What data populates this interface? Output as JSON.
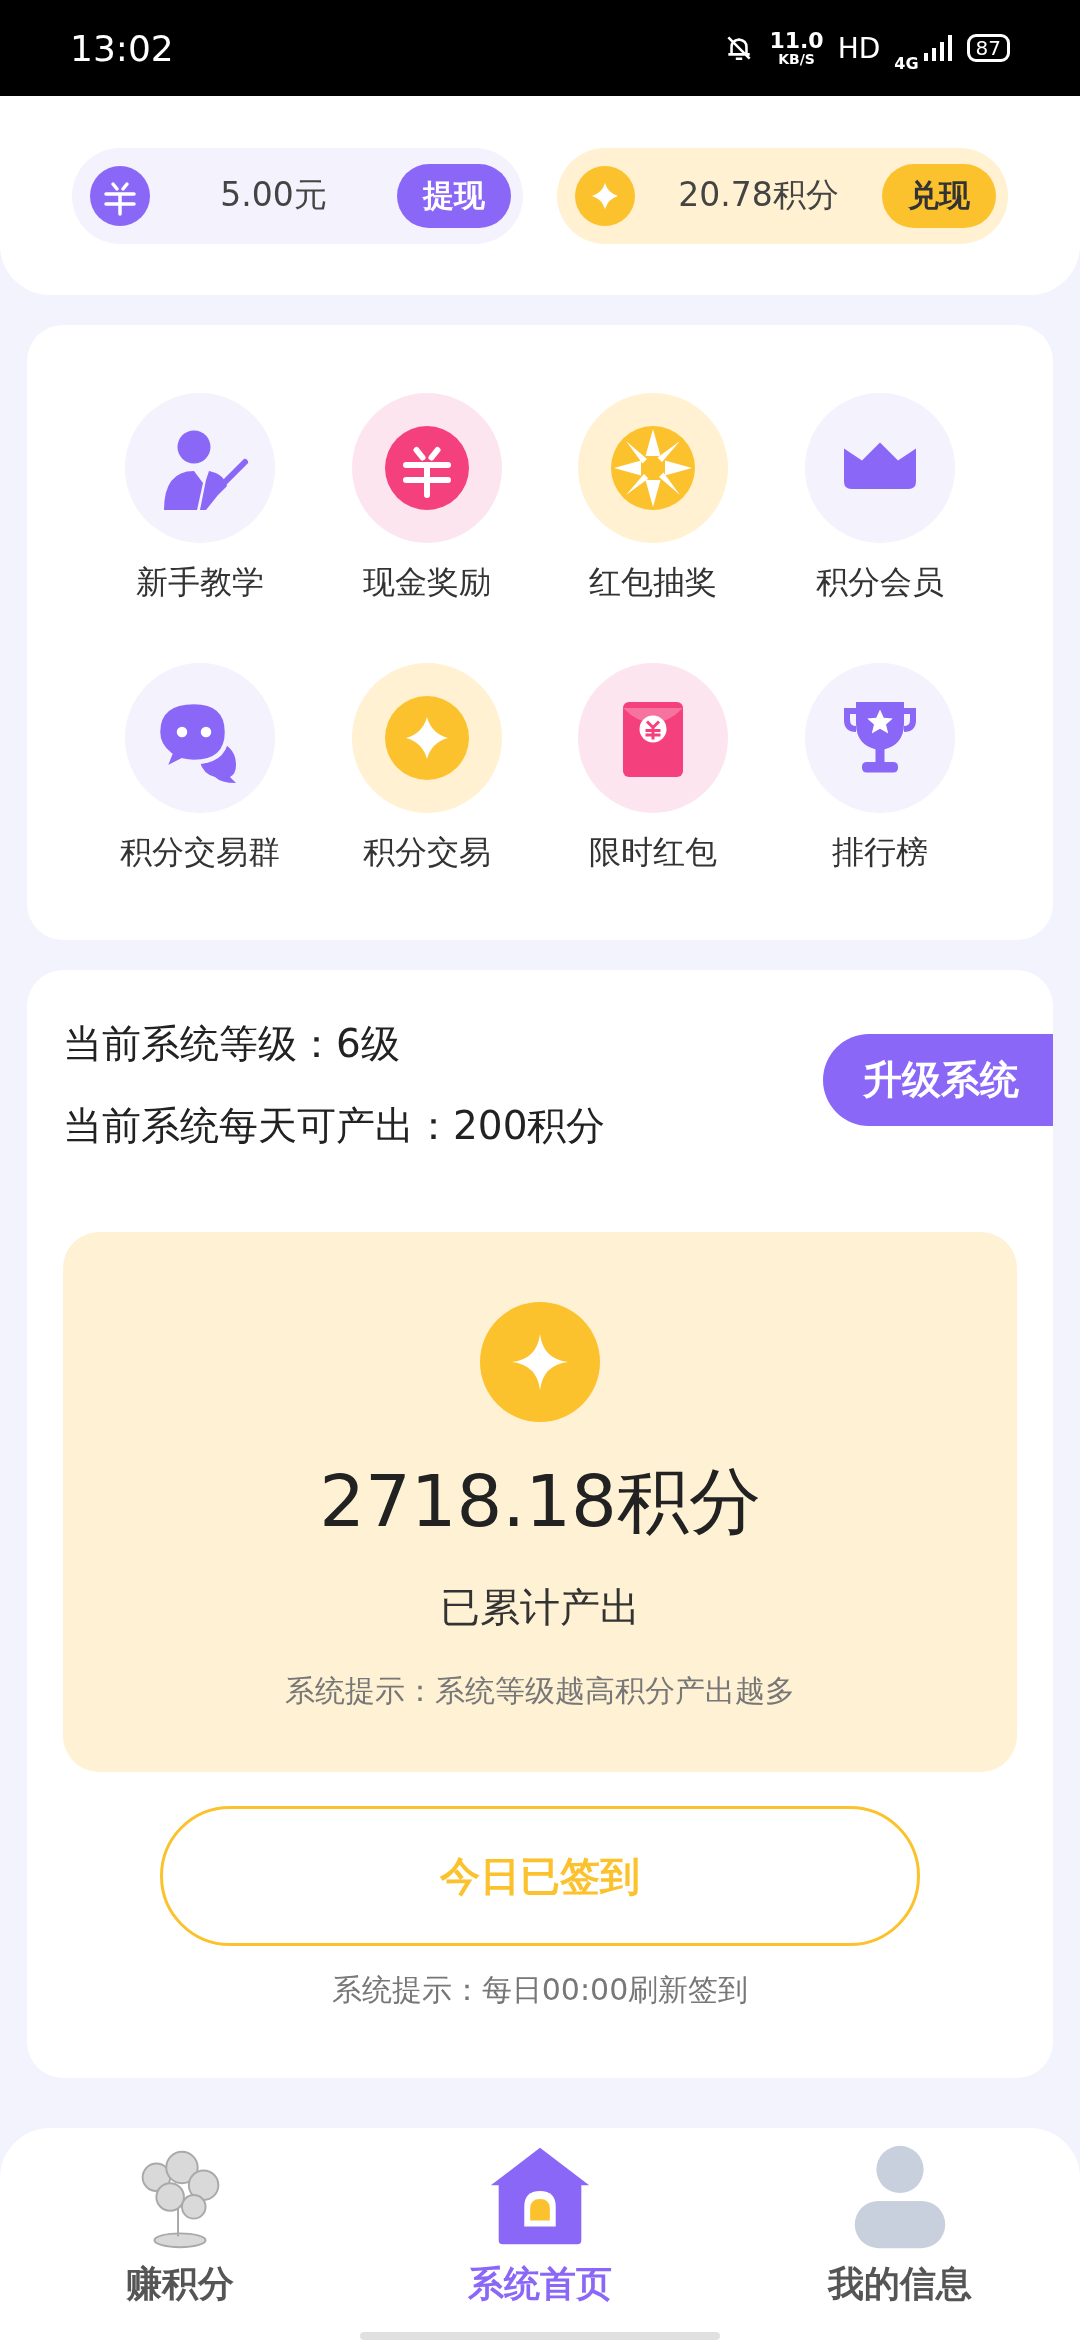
{
  "status_bar": {
    "time": "13:02",
    "speed": "11.0",
    "speed_unit": "KB/S",
    "hd": "HD",
    "network": "4G",
    "battery": "87"
  },
  "balances": [
    {
      "kind": "cash",
      "amount": "5.00元",
      "button": "提现"
    },
    {
      "kind": "points",
      "amount": "20.78积分",
      "button": "兑现"
    }
  ],
  "shortcuts": [
    {
      "kind": "teacher",
      "label": "新手教学"
    },
    {
      "kind": "yuan",
      "label": "现金奖励"
    },
    {
      "kind": "wheel",
      "label": "红包抽奖"
    },
    {
      "kind": "crown",
      "label": "积分会员"
    },
    {
      "kind": "chat",
      "label": "积分交易群"
    },
    {
      "kind": "coin",
      "label": "积分交易"
    },
    {
      "kind": "envelope",
      "label": "限时红包"
    },
    {
      "kind": "trophy",
      "label": "排行榜"
    }
  ],
  "system": {
    "level_line": "当前系统等级：6级",
    "output_line": "当前系统每天可产出：200积分",
    "upgrade_button": "升级系统",
    "total": "2718.18积分",
    "total_label": "已累计产出",
    "tip": "系统提示：系统等级越高积分产出越多",
    "sign_button": "今日已签到",
    "sign_tip": "系统提示：每日00:00刷新签到"
  },
  "bottom_nav": [
    {
      "kind": "earn",
      "label": "赚积分",
      "selected": false
    },
    {
      "kind": "home",
      "label": "系统首页",
      "selected": true
    },
    {
      "kind": "profile",
      "label": "我的信息",
      "selected": false
    }
  ]
}
